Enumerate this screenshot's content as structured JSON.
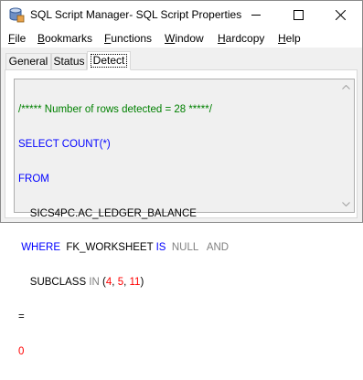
{
  "window": {
    "title": "SQL Script Manager- SQL Script Properties",
    "icon": "database-icon"
  },
  "menu": {
    "items": [
      {
        "ul": "F",
        "rest": "ile"
      },
      {
        "ul": "B",
        "rest": "ookmarks"
      },
      {
        "ul": "F",
        "rest": "unctions"
      },
      {
        "ul": "W",
        "rest": "indow"
      },
      {
        "ul": "H",
        "rest": "ardcopy"
      },
      {
        "ul": "H",
        "rest": "elp"
      }
    ]
  },
  "tabs": {
    "items": [
      "General",
      "Status",
      "Detect"
    ],
    "active": "Detect"
  },
  "editor": {
    "line1": "/***** Number of rows detected = 28 *****/",
    "select_kw": "SELECT COUNT(*)",
    "from_kw": "FROM",
    "table": "SICS4PC.AC_LEDGER_BALANCE",
    "where_kw": "WHERE",
    "where_col": "FK_WORKSHEET",
    "is_kw": "IS",
    "null_kw": "NULL",
    "and_kw": "AND",
    "subclass_col": "SUBCLASS",
    "in_kw": "IN",
    "in_open": "(",
    "in_v1": "4",
    "in_comma1": ", ",
    "in_v2": "5",
    "in_comma2": ", ",
    "in_v3": "11",
    "in_close": ")",
    "eq_line": "=",
    "result_line": "0"
  },
  "colors": {
    "keyword": "#0000ff",
    "comment": "#008000",
    "number": "#ff0000",
    "null_and": "#808080"
  }
}
